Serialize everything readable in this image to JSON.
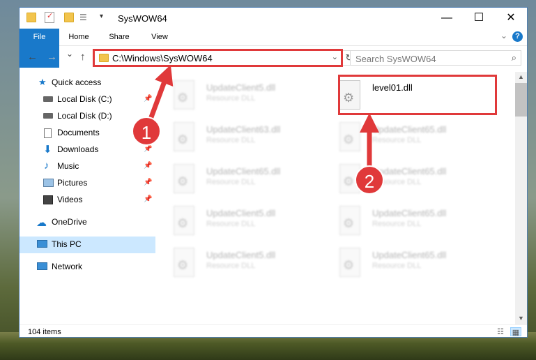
{
  "window": {
    "title": "SysWOW64",
    "controls": {
      "minimize": "—",
      "maximize": "☐",
      "close": "✕"
    }
  },
  "ribbon": {
    "tabs": [
      "File",
      "Home",
      "Share",
      "View"
    ],
    "help": "?",
    "collapse_icon": "chevron-down-icon"
  },
  "navigation": {
    "back": "←",
    "forward": "→",
    "recent": "⌄",
    "up": "↑",
    "address": "C:\\Windows\\SysWOW64",
    "address_dropdown": "⌄",
    "refresh": "↻",
    "search_placeholder": "Search SysWOW64",
    "search_icon": "⌕"
  },
  "sidebar": {
    "quick_access": "Quick access",
    "items": [
      {
        "label": "Local Disk (C:)",
        "icon": "drive-icon",
        "pinned": true
      },
      {
        "label": "Local Disk (D:)",
        "icon": "drive-icon",
        "pinned": false
      },
      {
        "label": "Documents",
        "icon": "documents-icon",
        "pinned": true
      },
      {
        "label": "Downloads",
        "icon": "downloads-icon",
        "pinned": true
      },
      {
        "label": "Music",
        "icon": "music-icon",
        "pinned": true
      },
      {
        "label": "Pictures",
        "icon": "pictures-icon",
        "pinned": true
      },
      {
        "label": "Videos",
        "icon": "videos-icon",
        "pinned": true
      }
    ],
    "onedrive": "OneDrive",
    "this_pc": "This PC",
    "network": "Network"
  },
  "files": [
    {
      "name": "UpdateClient5.dll",
      "type": "Resource DLL"
    },
    {
      "name": "level01.dll",
      "type": ""
    },
    {
      "name": "UpdateClient63.dll",
      "type": "Resource DLL"
    },
    {
      "name": "UpdateClient65.dll",
      "type": "Resource DLL"
    },
    {
      "name": "UpdateClient65.dll",
      "type": "Resource DLL"
    },
    {
      "name": "UpdateClient65.dll",
      "type": "Resource DLL"
    },
    {
      "name": "UpdateClient5.dll",
      "type": "Resource DLL"
    },
    {
      "name": "UpdateClient65.dll",
      "type": "Resource DLL"
    },
    {
      "name": "UpdateClient5.dll",
      "type": "Resource DLL"
    },
    {
      "name": "UpdateClient65.dll",
      "type": "Resource DLL"
    }
  ],
  "status": {
    "item_count": "104 items"
  },
  "callouts": [
    "1",
    "2"
  ],
  "colors": {
    "accent": "#1979ca",
    "highlight": "#e0393a",
    "selected": "#cce8ff"
  }
}
